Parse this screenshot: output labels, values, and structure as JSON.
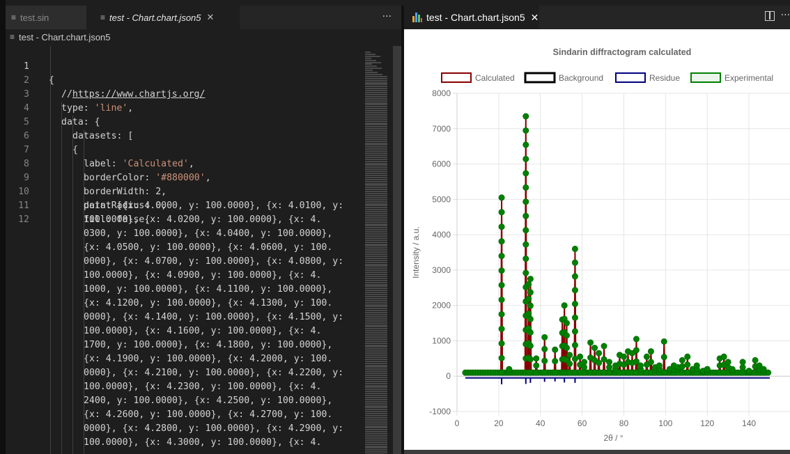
{
  "left_editor": {
    "tabs": [
      {
        "label": "test.sin",
        "icon": "lines-icon",
        "active": false
      },
      {
        "label": "test - Chart.chart.json5",
        "icon": "lines-icon",
        "active": true
      }
    ],
    "more_label": "···",
    "close_glyph": "✕",
    "breadcrumb": "test - Chart.chart.json5",
    "line_numbers": [
      "1",
      "2",
      "3",
      "4",
      "5",
      "6",
      "7",
      "8",
      "9",
      "10",
      "11",
      "12"
    ],
    "code": {
      "l1": "{",
      "l2_prefix": "//",
      "l2_link": "https://www.chartjs.org/",
      "l3_key": "type: ",
      "l3_val": "'line'",
      "l3_tail": ",",
      "l4": "data: {",
      "l5": "datasets: [",
      "l6": "{",
      "l7_key": "label: ",
      "l7_val": "'Calculated'",
      "l7_tail": ",",
      "l8_key": "borderColor: ",
      "l8_val": "'#880000'",
      "l8_tail": ",",
      "l9": "borderWidth: 2,",
      "l10": "pointRadius: 0,",
      "l11": "fill: false,",
      "l12_wrapped": [
        "data: [{x: 4.0000, y: 100.0000}, {x: 4.0100, y:",
        "100.0000}, {x: 4.0200, y: 100.0000}, {x: 4.",
        "0300, y: 100.0000}, {x: 4.0400, y: 100.0000},",
        "{x: 4.0500, y: 100.0000}, {x: 4.0600, y: 100.",
        "0000}, {x: 4.0700, y: 100.0000}, {x: 4.0800, y:",
        "100.0000}, {x: 4.0900, y: 100.0000}, {x: 4.",
        "1000, y: 100.0000}, {x: 4.1100, y: 100.0000},",
        "{x: 4.1200, y: 100.0000}, {x: 4.1300, y: 100.",
        "0000}, {x: 4.1400, y: 100.0000}, {x: 4.1500, y:",
        "100.0000}, {x: 4.1600, y: 100.0000}, {x: 4.",
        "1700, y: 100.0000}, {x: 4.1800, y: 100.0000},",
        "{x: 4.1900, y: 100.0000}, {x: 4.2000, y: 100.",
        "0000}, {x: 4.2100, y: 100.0000}, {x: 4.2200, y:",
        "100.0000}, {x: 4.2300, y: 100.0000}, {x: 4.",
        "2400, y: 100.0000}, {x: 4.2500, y: 100.0000},",
        "{x: 4.2600, y: 100.0000}, {x: 4.2700, y: 100.",
        "0000}, {x: 4.2800, y: 100.0000}, {x: 4.2900, y:",
        "100.0000}, {x: 4.3000, y: 100.0000}, {x: 4."
      ]
    }
  },
  "right_preview": {
    "tab_label": "test - Chart.chart.json5",
    "tab_icon": "bar-chart-icon",
    "close_glyph": "✕",
    "split_icon": "split-editor-icon",
    "more_label": "···"
  },
  "chart_data": {
    "type": "line",
    "title": "Sindarin diffractogram calculated",
    "xlabel": "2θ / °",
    "ylabel": "Intensity / a.u.",
    "xlim": [
      0,
      155
    ],
    "ylim": [
      -1000,
      8000
    ],
    "x_ticks": [
      "0",
      "20",
      "40",
      "60",
      "80",
      "100",
      "120",
      "140"
    ],
    "y_ticks": [
      "-1000",
      "0",
      "1000",
      "2000",
      "3000",
      "4000",
      "5000",
      "6000",
      "7000",
      "8000"
    ],
    "grid": true,
    "legend_position": "top",
    "legend": [
      {
        "name": "Calculated",
        "color": "#880000"
      },
      {
        "name": "Background",
        "color": "#000000"
      },
      {
        "name": "Residue",
        "color": "#000080"
      },
      {
        "name": "Experimental",
        "color": "#008000"
      }
    ],
    "baseline": 100,
    "x_range": [
      4,
      150
    ],
    "calculated_peaks": [
      {
        "x": 21.4,
        "y": 5050
      },
      {
        "x": 25,
        "y": 200
      },
      {
        "x": 33.0,
        "y": 7350
      },
      {
        "x": 34.3,
        "y": 2600
      },
      {
        "x": 35.2,
        "y": 2750
      },
      {
        "x": 38,
        "y": 500
      },
      {
        "x": 42,
        "y": 1100
      },
      {
        "x": 47,
        "y": 750
      },
      {
        "x": 50.5,
        "y": 1600
      },
      {
        "x": 51.5,
        "y": 2000
      },
      {
        "x": 52.6,
        "y": 1500
      },
      {
        "x": 54,
        "y": 600
      },
      {
        "x": 56.6,
        "y": 3600
      },
      {
        "x": 59,
        "y": 550
      },
      {
        "x": 61,
        "y": 400
      },
      {
        "x": 64,
        "y": 950
      },
      {
        "x": 66,
        "y": 800
      },
      {
        "x": 68,
        "y": 650
      },
      {
        "x": 70.5,
        "y": 850
      },
      {
        "x": 73,
        "y": 400
      },
      {
        "x": 76,
        "y": 300
      },
      {
        "x": 78,
        "y": 600
      },
      {
        "x": 80,
        "y": 550
      },
      {
        "x": 82,
        "y": 700
      },
      {
        "x": 84,
        "y": 650
      },
      {
        "x": 86,
        "y": 1050
      },
      {
        "x": 88,
        "y": 300
      },
      {
        "x": 91,
        "y": 550
      },
      {
        "x": 93,
        "y": 700
      },
      {
        "x": 95,
        "y": 250
      },
      {
        "x": 97,
        "y": 300
      },
      {
        "x": 99.3,
        "y": 980
      },
      {
        "x": 102,
        "y": 200
      },
      {
        "x": 104,
        "y": 300
      },
      {
        "x": 106,
        "y": 250
      },
      {
        "x": 108,
        "y": 450
      },
      {
        "x": 110.5,
        "y": 550
      },
      {
        "x": 113,
        "y": 200
      },
      {
        "x": 115,
        "y": 300
      },
      {
        "x": 118,
        "y": 150
      },
      {
        "x": 120,
        "y": 200
      },
      {
        "x": 126,
        "y": 500
      },
      {
        "x": 128,
        "y": 550
      },
      {
        "x": 130,
        "y": 400
      },
      {
        "x": 132,
        "y": 200
      },
      {
        "x": 137,
        "y": 400
      },
      {
        "x": 140,
        "y": 150
      },
      {
        "x": 143,
        "y": 450
      },
      {
        "x": 145,
        "y": 300
      },
      {
        "x": 147,
        "y": 200
      }
    ],
    "residue_spikes": [
      {
        "x": 21.4,
        "y": -130
      },
      {
        "x": 33.0,
        "y": -120
      },
      {
        "x": 35.2,
        "y": -90
      },
      {
        "x": 42,
        "y": -60
      },
      {
        "x": 47,
        "y": -50
      },
      {
        "x": 51.5,
        "y": -80
      },
      {
        "x": 56.6,
        "y": -90
      }
    ],
    "residue_level": -50
  }
}
